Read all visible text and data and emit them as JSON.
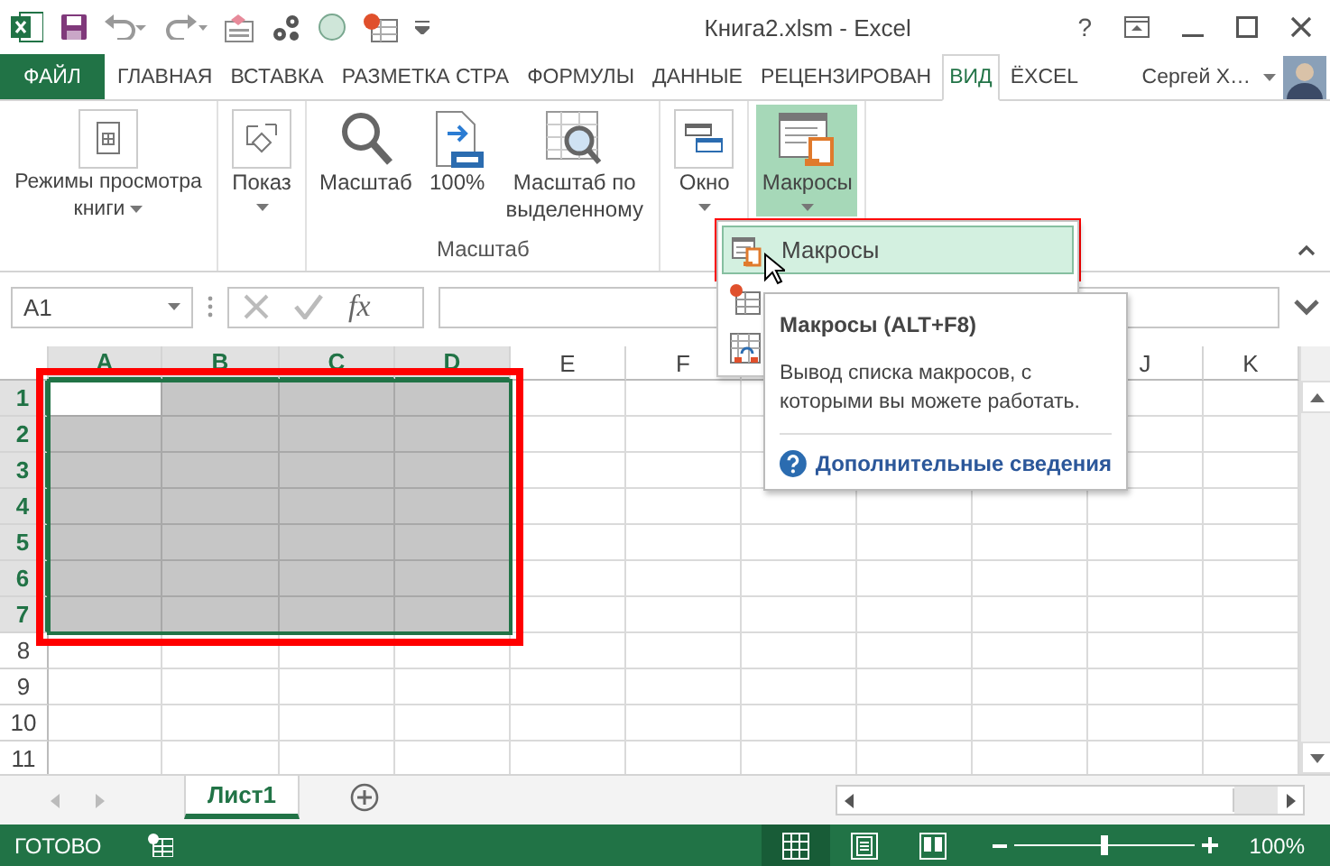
{
  "title_bar": {
    "title": "Книга2.xlsm - Excel",
    "help": "?"
  },
  "ribbon_tabs": [
    {
      "label": "ФАЙЛ",
      "kind": "file",
      "selected": false
    },
    {
      "label": "ГЛАВНАЯ",
      "kind": "tab",
      "selected": false
    },
    {
      "label": "ВСТАВКА",
      "kind": "tab",
      "selected": false
    },
    {
      "label": "РАЗМЕТКА СТРА",
      "kind": "tab",
      "selected": false
    },
    {
      "label": "ФОРМУЛЫ",
      "kind": "tab",
      "selected": false
    },
    {
      "label": "ДАННЫЕ",
      "kind": "tab",
      "selected": false
    },
    {
      "label": "РЕЦЕНЗИРОВАН",
      "kind": "tab",
      "selected": false
    },
    {
      "label": "ВИД",
      "kind": "tab",
      "selected": true
    },
    {
      "label": "ЁXCEL",
      "kind": "tab",
      "selected": false
    }
  ],
  "account": {
    "name": "Сергей Х…"
  },
  "ribbon_groups": [
    {
      "buttons": [
        {
          "kind": "views",
          "label": "Режимы просмотра книги",
          "dropdown": true,
          "pressed": false
        }
      ]
    },
    {
      "buttons": [
        {
          "kind": "show",
          "label": "Показ",
          "dropdown": true,
          "pressed": false
        }
      ]
    },
    {
      "label": "Масштаб",
      "buttons": [
        {
          "kind": "zoom",
          "label": "Масштаб",
          "dropdown": false,
          "pressed": false
        },
        {
          "kind": "zoom100",
          "label": "100%",
          "dropdown": false,
          "pressed": false
        },
        {
          "kind": "zoomsel",
          "label": "Масштаб по выделенному",
          "dropdown": false,
          "pressed": false
        }
      ]
    },
    {
      "buttons": [
        {
          "kind": "window",
          "label": "Окно",
          "dropdown": true,
          "pressed": false
        }
      ]
    },
    {
      "buttons": [
        {
          "kind": "macros",
          "label": "Макросы",
          "dropdown": true,
          "pressed": true
        }
      ]
    }
  ],
  "macros_menu": {
    "callout": true,
    "items": [
      {
        "kind": "view",
        "label": "Макросы",
        "highlighted": true
      },
      {
        "kind": "record",
        "highlighted": false
      },
      {
        "kind": "relative",
        "highlighted": false
      }
    ]
  },
  "tooltip": {
    "title": "Макросы (ALT+F8)",
    "text": "Вывод списка макросов, с которыми вы можете работать.",
    "link": "Дополнительные сведения"
  },
  "formula_bar": {
    "name_box": "A1",
    "function_label": "fx"
  },
  "sheet": {
    "callout": true,
    "columns": [
      {
        "label": "A",
        "selected": true
      },
      {
        "label": "B",
        "selected": true
      },
      {
        "label": "C",
        "selected": true
      },
      {
        "label": "D",
        "selected": true
      },
      {
        "label": "E",
        "selected": false
      },
      {
        "label": "F",
        "selected": false
      },
      {},
      {},
      {},
      {
        "label": "J",
        "selected": false
      },
      {
        "label": "K",
        "selected": false
      }
    ],
    "rows": [
      {
        "label": "1",
        "selected": true
      },
      {
        "label": "2",
        "selected": true
      },
      {
        "label": "3",
        "selected": true
      },
      {
        "label": "4",
        "selected": true
      },
      {
        "label": "5",
        "selected": true
      },
      {
        "label": "6",
        "selected": true
      },
      {
        "label": "7",
        "selected": true
      },
      {
        "label": "8",
        "selected": false
      },
      {
        "label": "9",
        "selected": false
      },
      {
        "label": "10",
        "selected": false
      },
      {
        "label": "11",
        "selected": false
      }
    ]
  },
  "sheet_tabs": [
    {
      "label": "Лист1",
      "selected": true
    }
  ],
  "status_bar": {
    "status": "ГОТОВО",
    "views": [
      {
        "kind": "normal",
        "selected": true
      },
      {
        "kind": "layout",
        "selected": false
      },
      {
        "kind": "pagebreak",
        "selected": false
      }
    ],
    "zoom": {
      "level": 0.5,
      "reading": "100%"
    }
  }
}
